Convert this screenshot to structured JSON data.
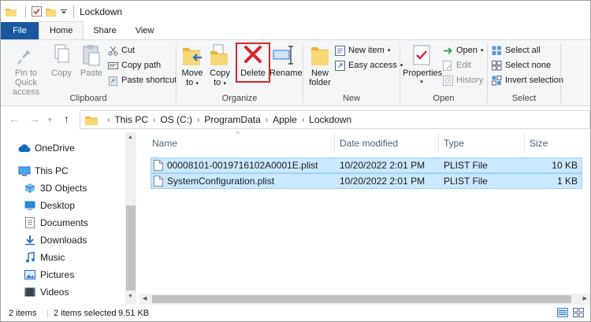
{
  "window": {
    "title": "Lockdown"
  },
  "tabs": [
    "File",
    "Home",
    "Share",
    "View"
  ],
  "ribbon": {
    "clipboard": {
      "label": "Clipboard",
      "pin_label_1": "Pin to Quick",
      "pin_label_2": "access",
      "copy": "Copy",
      "paste": "Paste",
      "cut": "Cut",
      "copy_path": "Copy path",
      "paste_shortcut": "Paste shortcut"
    },
    "organize": {
      "label": "Organize",
      "move_to_1": "Move",
      "move_to_2": "to",
      "copy_to_1": "Copy",
      "copy_to_2": "to",
      "delete": "Delete",
      "rename": "Rename"
    },
    "new": {
      "label": "New",
      "new_folder_1": "New",
      "new_folder_2": "folder",
      "new_item": "New item",
      "easy_access": "Easy access"
    },
    "open": {
      "label": "Open",
      "properties": "Properties",
      "open": "Open",
      "edit": "Edit",
      "history": "History"
    },
    "select": {
      "label": "Select",
      "select_all": "Select all",
      "select_none": "Select none",
      "invert_selection": "Invert selection"
    }
  },
  "address": {
    "breadcrumbs": [
      "This PC",
      "OS (C:)",
      "ProgramData",
      "Apple",
      "Lockdown"
    ]
  },
  "navpane": {
    "items": [
      "OneDrive",
      "This PC",
      "3D Objects",
      "Desktop",
      "Documents",
      "Downloads",
      "Music",
      "Pictures",
      "Videos"
    ]
  },
  "columns": {
    "name": "Name",
    "date": "Date modified",
    "type": "Type",
    "size": "Size"
  },
  "files": [
    {
      "name": "00008101-0019716102A0001E.plist",
      "date": "10/20/2022 2:01 PM",
      "type": "PLIST File",
      "size": "10 KB"
    },
    {
      "name": "SystemConfiguration.plist",
      "date": "10/20/2022 2:01 PM",
      "type": "PLIST File",
      "size": "1 KB"
    }
  ],
  "status": {
    "count": "2 items",
    "selected": "2 items selected",
    "size": "9.51 KB"
  },
  "colors": {
    "file_tab": "#19589f",
    "selection": "#cce8ff",
    "selection_border": "#99d1ff",
    "delete_highlight": "#d9262a"
  }
}
